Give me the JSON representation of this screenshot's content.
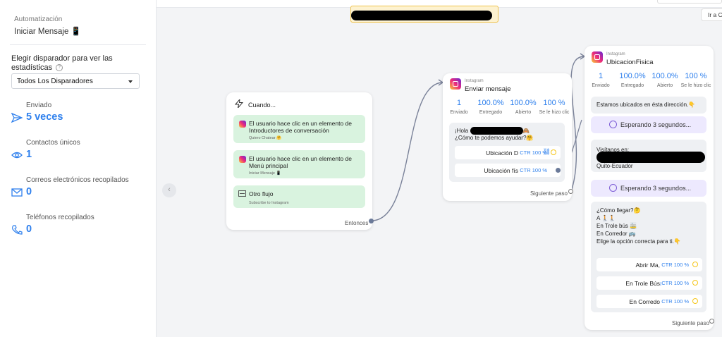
{
  "sidebar": {
    "breadcrumb": "Automatización",
    "title": "Iniciar Mensaje 📱",
    "trigger_label": "Elegir disparador para ver las estadísticas",
    "trigger_select": "Todos Los Disparadores",
    "stats": [
      {
        "label": "Enviado",
        "value": "5 veces",
        "icon": "send-icon"
      },
      {
        "label": "Contactos únicos",
        "value": "1",
        "icon": "eye-icon"
      },
      {
        "label": "Correos electrónicos recopilados",
        "value": "0",
        "icon": "mail-icon"
      },
      {
        "label": "Teléfonos recopilados",
        "value": "0",
        "icon": "phone-icon"
      }
    ]
  },
  "canvas": {
    "goto_button": "Ir a C",
    "collapse_icon": "‹",
    "accent_color": "#2f80ed"
  },
  "trigger_card": {
    "title": "Cuando...",
    "icon": "lightning-icon",
    "items": [
      {
        "text": "El usuario hace clic en un elemento de Introductores de conversación",
        "sub": "Quiero Chatear 🤗"
      },
      {
        "text": "El usuario hace clic en un elemento de Menú principal",
        "sub": "Iniciar Mensaje 📱"
      },
      {
        "text": "Otro flujo",
        "sub": "Subscribe to Instagram"
      }
    ],
    "footer": "Entonces"
  },
  "send_card": {
    "platform": "Instagram",
    "name": "Enviar mensaje",
    "metrics": [
      {
        "n": "1",
        "l": "Enviado"
      },
      {
        "n": "100.0%",
        "l": "Entregado"
      },
      {
        "n": "100.0%",
        "l": "Abierto"
      },
      {
        "n": "100 %",
        "l": "Se le hizo clic"
      }
    ],
    "greeting": "¡Hola",
    "greeting_emoji": "🙈",
    "question": "¿Cómo te podemos ayudar?🤗",
    "buttons": [
      {
        "label": "Ubicación D",
        "ctr": "CTR 100 %"
      },
      {
        "label": "Ubicación fís",
        "ctr": "CTR 100 %"
      }
    ],
    "footer": "Siguiente paso"
  },
  "location_card": {
    "platform": "Instagram",
    "name": "UbicacionFisica",
    "metrics": [
      {
        "n": "1",
        "l": "Enviado"
      },
      {
        "n": "100.0%",
        "l": "Entregado"
      },
      {
        "n": "100.0%",
        "l": "Abierto"
      },
      {
        "n": "100 %",
        "l": "Se le hizo clic"
      }
    ],
    "intro": "Estamos ubicados en ésta dirección.👇",
    "wait1": "Esperando 3 segundos...",
    "visit_label": "Visítanos en:",
    "visit_city": "Quito-Ecuador",
    "wait2": "Esperando 3 segundos...",
    "how_lines": [
      "¿Cómo llegar?🤔",
      "A 🚶🚶",
      "En Trole bús 🚋",
      "En Corredor 🚌",
      "Elige la opción correcta para ti.👇"
    ],
    "buttons": [
      {
        "label": "Abrir Ma,",
        "ctr": "CTR 100 %"
      },
      {
        "label": "En Trole Bús",
        "ctr": "¡CTR 100 %"
      },
      {
        "label": "En Corredo",
        "ctr": "CTR 100 %"
      }
    ],
    "footer": "Siguiente paso"
  }
}
